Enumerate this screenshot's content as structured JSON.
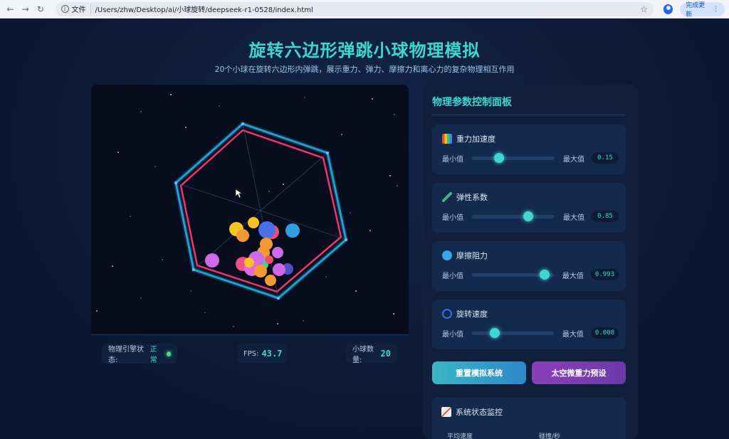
{
  "browser": {
    "file_label": "文件",
    "url": "/Users/zhw/Desktop/ai/小球旋转/deepseek-r1-0528/index.html",
    "update_label": "完成更新"
  },
  "header": {
    "title": "旋转六边形弹跳小球物理模拟",
    "subtitle": "20个小球在旋转六边形内弹跳，展示重力、弹力、摩擦力和离心力的复杂物理相互作用"
  },
  "stats": {
    "engine_label": "物理引擎状态:",
    "engine_status": "正常",
    "fps_label": "FPS:",
    "fps_value": "43.7",
    "balls_label": "小球数量:",
    "balls_value": "20"
  },
  "panel": {
    "title": "物理参数控制面板",
    "params": [
      {
        "label": "重力加速度",
        "min_label": "最小值",
        "max_label": "最大值",
        "value": "0.15",
        "level": 0.33,
        "icon_color": "#4f7cf0"
      },
      {
        "label": "弹性系数",
        "min_label": "最小值",
        "max_label": "最大值",
        "value": "0.85",
        "level": 0.68,
        "icon_color": "#43b581"
      },
      {
        "label": "摩擦阻力",
        "min_label": "最小值",
        "max_label": "最大值",
        "value": "0.993",
        "level": 0.89,
        "icon_color": "#38a6e8"
      },
      {
        "label": "旋转速度",
        "min_label": "最小值",
        "max_label": "最大值",
        "value": "0.008",
        "level": 0.28,
        "icon_color": "#3b6fe0"
      }
    ],
    "reset_label": "重置模拟系统",
    "space_label": "太空微重力预设",
    "monitor_title": "系统状态监控",
    "monitor_avg_speed": "平均速度",
    "monitor_collisions": "碰撞/秒"
  },
  "colors": {
    "accent": "#3fd6d0",
    "hex_outer": "#2aa8e0",
    "hex_inner": "#f0346e"
  }
}
